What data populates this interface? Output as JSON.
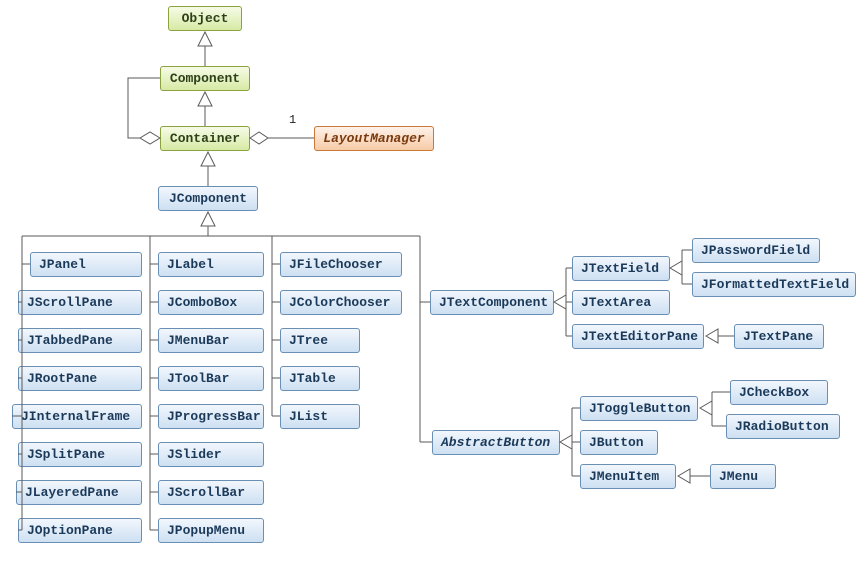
{
  "nodes": {
    "object": "Object",
    "component": "Component",
    "container": "Container",
    "layoutmanager": "LayoutManager",
    "jcomponent": "JComponent",
    "jpanel": "JPanel",
    "jscrollpane": "JScrollPane",
    "jtabbedpane": "JTabbedPane",
    "jrootpane": "JRootPane",
    "jinternalframe": "JInternalFrame",
    "jsplitpane": "JSplitPane",
    "jlayeredpane": "JLayeredPane",
    "joptionpane": "JOptionPane",
    "jlabel": "JLabel",
    "jcombobox": "JComboBox",
    "jmenubar": "JMenuBar",
    "jtoolbar": "JToolBar",
    "jprogressbar": "JProgressBar",
    "jslider": "JSlider",
    "jscrollbar": "JScrollBar",
    "jpopupmenu": "JPopupMenu",
    "jfilechooser": "JFileChooser",
    "jcolorchooser": "JColorChooser",
    "jtree": "JTree",
    "jtable": "JTable",
    "jlist": "JList",
    "jtextcomponent": "JTextComponent",
    "jtextfield": "JTextField",
    "jtextarea": "JTextArea",
    "jtexteditorpane": "JTextEditorPane",
    "jpasswordfield": "JPasswordField",
    "jformattedtextfield": "JFormattedTextField",
    "jtextpane": "JTextPane",
    "abstractbutton": "AbstractButton",
    "jtogglebutton": "JToggleButton",
    "jbutton": "JButton",
    "jmenuitem": "JMenuItem",
    "jcheckbox": "JCheckBox",
    "jradiobutton": "JRadioButton",
    "jmenu": "JMenu"
  },
  "labels": {
    "containerLayoutMult": "1"
  },
  "chart_data": {
    "type": "uml-class-hierarchy",
    "title": "Swing component class hierarchy",
    "classes": [
      "Object",
      "Component",
      "Container",
      "LayoutManager",
      "JComponent",
      "JPanel",
      "JScrollPane",
      "JTabbedPane",
      "JRootPane",
      "JInternalFrame",
      "JSplitPane",
      "JLayeredPane",
      "JOptionPane",
      "JLabel",
      "JComboBox",
      "JMenuBar",
      "JToolBar",
      "JProgressBar",
      "JSlider",
      "JScrollBar",
      "JPopupMenu",
      "JFileChooser",
      "JColorChooser",
      "JTree",
      "JTable",
      "JList",
      "JTextComponent",
      "JTextField",
      "JTextArea",
      "JTextEditorPane",
      "JPasswordField",
      "JFormattedTextField",
      "JTextPane",
      "AbstractButton",
      "JToggleButton",
      "JButton",
      "JMenuItem",
      "JCheckBox",
      "JRadioButton",
      "JMenu"
    ],
    "interfaces": [
      "LayoutManager"
    ],
    "abstract": [
      "AbstractButton"
    ],
    "generalizations": [
      [
        "Component",
        "Object"
      ],
      [
        "Container",
        "Component"
      ],
      [
        "JComponent",
        "Container"
      ],
      [
        "JPanel",
        "JComponent"
      ],
      [
        "JScrollPane",
        "JComponent"
      ],
      [
        "JTabbedPane",
        "JComponent"
      ],
      [
        "JRootPane",
        "JComponent"
      ],
      [
        "JInternalFrame",
        "JComponent"
      ],
      [
        "JSplitPane",
        "JComponent"
      ],
      [
        "JLayeredPane",
        "JComponent"
      ],
      [
        "JOptionPane",
        "JComponent"
      ],
      [
        "JLabel",
        "JComponent"
      ],
      [
        "JComboBox",
        "JComponent"
      ],
      [
        "JMenuBar",
        "JComponent"
      ],
      [
        "JToolBar",
        "JComponent"
      ],
      [
        "JProgressBar",
        "JComponent"
      ],
      [
        "JSlider",
        "JComponent"
      ],
      [
        "JScrollBar",
        "JComponent"
      ],
      [
        "JPopupMenu",
        "JComponent"
      ],
      [
        "JFileChooser",
        "JComponent"
      ],
      [
        "JColorChooser",
        "JComponent"
      ],
      [
        "JTree",
        "JComponent"
      ],
      [
        "JTable",
        "JComponent"
      ],
      [
        "JList",
        "JComponent"
      ],
      [
        "JTextComponent",
        "JComponent"
      ],
      [
        "AbstractButton",
        "JComponent"
      ],
      [
        "JTextField",
        "JTextComponent"
      ],
      [
        "JTextArea",
        "JTextComponent"
      ],
      [
        "JTextEditorPane",
        "JTextComponent"
      ],
      [
        "JPasswordField",
        "JTextField"
      ],
      [
        "JFormattedTextField",
        "JTextField"
      ],
      [
        "JTextPane",
        "JTextEditorPane"
      ],
      [
        "JToggleButton",
        "AbstractButton"
      ],
      [
        "JButton",
        "AbstractButton"
      ],
      [
        "JMenuItem",
        "AbstractButton"
      ],
      [
        "JCheckBox",
        "JToggleButton"
      ],
      [
        "JRadioButton",
        "JToggleButton"
      ],
      [
        "JMenu",
        "JMenuItem"
      ]
    ],
    "aggregations": [
      {
        "whole": "Container",
        "part": "Component",
        "multiplicity": "*"
      },
      {
        "whole": "Container",
        "part": "LayoutManager",
        "multiplicity": "1"
      }
    ]
  }
}
